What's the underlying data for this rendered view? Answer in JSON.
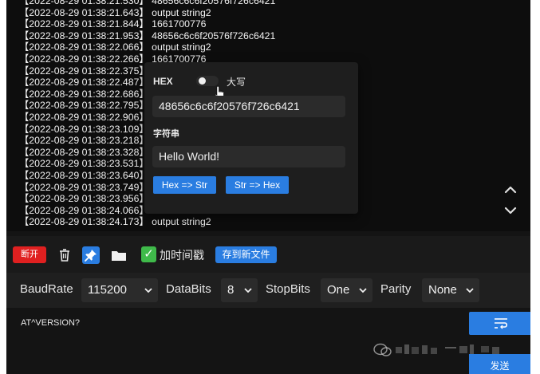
{
  "log": {
    "lines": [
      "【2022-08-29 01:38:21.530】 48656c6c6f20576f726c6421",
      "【2022-08-29 01:38:21.643】 output string2",
      "【2022-08-29 01:38:21.844】 1661700776",
      "【2022-08-29 01:38:21.953】 48656c6c6f20576f726c6421",
      "【2022-08-29 01:38:22.066】 output string2",
      "【2022-08-29 01:38:22.266】 1661700776",
      "【2022-08-29 01:38:22.375】",
      "【2022-08-29 01:38:22.487】",
      "【2022-08-29 01:38:22.686】",
      "【2022-08-29 01:38:22.795】",
      "【2022-08-29 01:38:22.906】",
      "【2022-08-29 01:38:23.109】",
      "【2022-08-29 01:38:23.218】",
      "【2022-08-29 01:38:23.328】",
      "【2022-08-29 01:38:23.531】",
      "【2022-08-29 01:38:23.640】",
      "【2022-08-29 01:38:23.749】",
      "【2022-08-29 01:38:23.956】",
      "【2022-08-29 01:38:24.066】",
      "【2022-08-29 01:38:24.173】 output string2"
    ],
    "scroll_up_icon": "chevron-up-icon",
    "scroll_down_icon": "chevron-down-icon"
  },
  "converter": {
    "hex_label": "HEX",
    "case_label": "大写",
    "hex_value": "48656c6c6f20576f726c6421",
    "string_label": "字符串",
    "string_value": "Hello World!",
    "hex_to_str_button": "Hex => Str",
    "str_to_hex_button": "Str => Hex"
  },
  "toolbar": {
    "disconnect_label": "断开",
    "timestamp_label": "加时间戳",
    "save_file_label": "存到新文件",
    "icons": [
      "trash-icon",
      "pin-icon",
      "folder-icon",
      "checkbox-checked-icon"
    ]
  },
  "settings": {
    "baudrate_label": "BaudRate",
    "baudrate_value": "115200",
    "databits_label": "DataBits",
    "databits_value": "8",
    "stopbits_label": "StopBits",
    "stopbits_value": "One",
    "parity_label": "Parity",
    "parity_value": "None"
  },
  "send": {
    "command_text": "AT^VERSION?",
    "send_label": "发送"
  },
  "colors": {
    "accent": "#2a7de1",
    "danger": "#e02020",
    "success": "#3fba4a",
    "background": "#141414"
  }
}
